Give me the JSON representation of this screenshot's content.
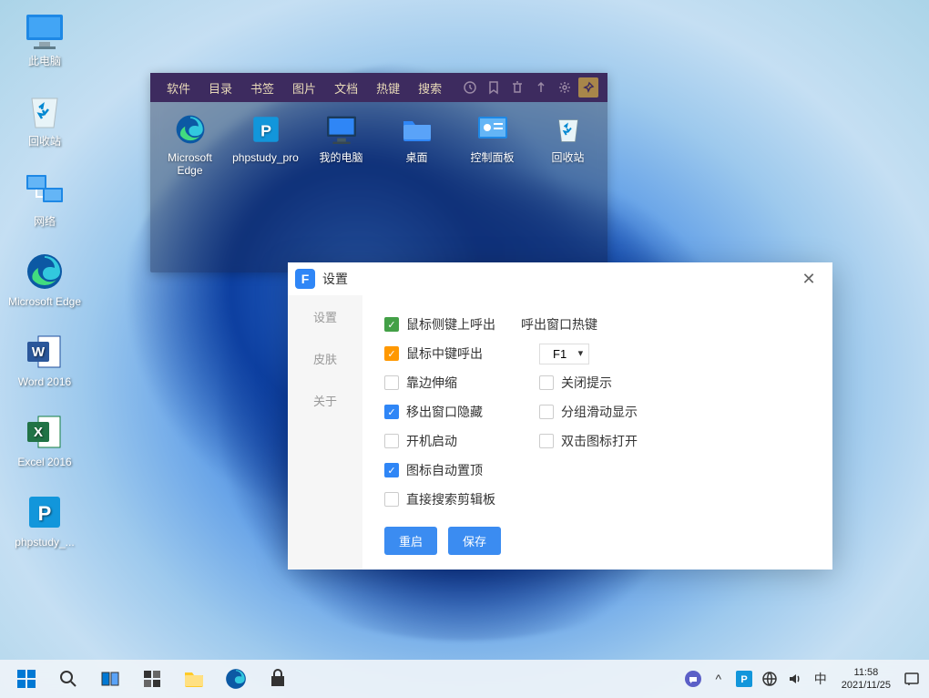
{
  "desktop_icons": [
    {
      "name": "此电脑",
      "icon": "pc"
    },
    {
      "name": "回收站",
      "icon": "recycle"
    },
    {
      "name": "网络",
      "icon": "network"
    },
    {
      "name": "Microsoft Edge",
      "icon": "edge"
    },
    {
      "name": "Word 2016",
      "icon": "word"
    },
    {
      "name": "Excel 2016",
      "icon": "excel"
    },
    {
      "name": "phpstudy_...",
      "icon": "phpstudy"
    }
  ],
  "launcher": {
    "menu": [
      "软件",
      "目录",
      "书签",
      "图片",
      "文档",
      "热键",
      "搜索"
    ],
    "tool_icons": [
      "history-icon",
      "bookmark-icon",
      "trash-icon",
      "upload-icon",
      "gear-icon",
      "pin-icon"
    ],
    "items": [
      {
        "label": "Microsoft Edge",
        "icon": "edge"
      },
      {
        "label": "phpstudy_pro",
        "icon": "phpstudy"
      },
      {
        "label": "我的电脑",
        "icon": "pc-dark"
      },
      {
        "label": "桌面",
        "icon": "folder"
      },
      {
        "label": "控制面板",
        "icon": "cpl"
      },
      {
        "label": "回收站",
        "icon": "recycle"
      }
    ]
  },
  "settings": {
    "title": "设置",
    "nav": [
      "设置",
      "皮肤",
      "关于"
    ],
    "opts": {
      "mouse_side": "鼠标侧键上呼出",
      "hotkey_heading": "呼出窗口热键",
      "mouse_mid": "鼠标中键呼出",
      "hotkey_value": "F1",
      "edge_expand": "靠边伸缩",
      "close_hint": "关闭提示",
      "hide_on_leave": "移出窗口隐藏",
      "group_scroll": "分组滑动显示",
      "startup": "开机启动",
      "dblclick_open": "双击图标打开",
      "auto_top": "图标自动置顶",
      "search_clipboard": "直接搜索剪辑板"
    },
    "buttons": {
      "restart": "重启",
      "save": "保存"
    }
  },
  "taskbar": {
    "items": [
      "start",
      "search",
      "taskview",
      "widgets",
      "explorer",
      "edge",
      "store"
    ],
    "tray": {
      "ime_lang": "中",
      "time": "11:58",
      "date": "2021/11/25"
    }
  }
}
